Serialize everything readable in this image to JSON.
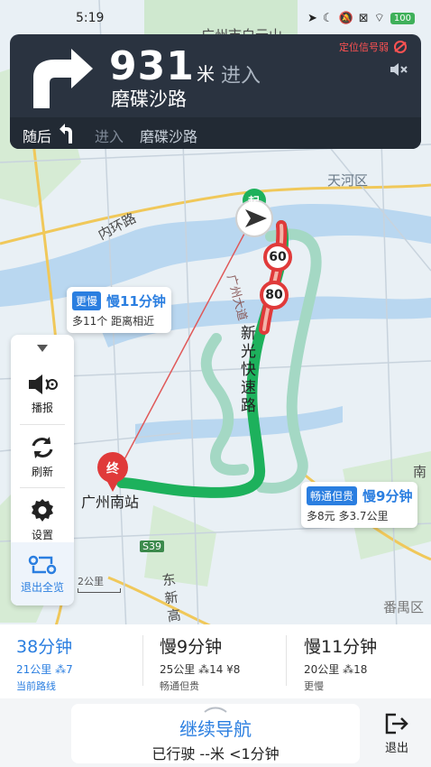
{
  "status_bar": {
    "time": "5:19",
    "battery": "100"
  },
  "nav": {
    "distance": "931",
    "unit": "米",
    "action": "进入",
    "road": "磨碟沙路",
    "gps_warning": "定位信号弱",
    "then_label": "随后",
    "then_action": "进入",
    "then_road": "磨碟沙路"
  },
  "map": {
    "labels": {
      "baiyun": "广州市白云山",
      "tianhe": "天河区",
      "inner_ring": "内环路",
      "xinguang": "新光快速路",
      "nan_station": "广州南站",
      "panyu": "番禺区",
      "nan": "南",
      "dongxin": "东新高速",
      "s39": "S39",
      "start": "起",
      "end": "终",
      "guangzhou_da": "广州大道"
    },
    "speed_signs": [
      "60",
      "80"
    ]
  },
  "bubbles": {
    "left": {
      "tag": "更慢",
      "slow": "慢11分钟",
      "detail": "多11个 距离相近"
    },
    "right": {
      "tag": "畅通但贵",
      "slow": "慢9分钟",
      "detail": "多8元 多3.7公里"
    }
  },
  "toolbar": {
    "broadcast": "播报",
    "refresh": "刷新",
    "settings": "设置",
    "overview": "退出全览"
  },
  "scale": "2公里",
  "routes": [
    {
      "time": "38分钟",
      "detail": "21公里 ⁂7",
      "note": "当前路线"
    },
    {
      "time": "慢9分钟",
      "detail": "25公里 ⁂14 ¥8",
      "note": "畅通但贵"
    },
    {
      "time": "慢11分钟",
      "detail": "20公里 ⁂18",
      "note": "更慢"
    }
  ],
  "bottom": {
    "continue": "继续导航",
    "traveled": "已行驶 --米 <1分钟",
    "exit": "退出"
  },
  "colors": {
    "accent": "#2a7ee0",
    "route_green": "#1db15c",
    "warning_red": "#e03a3a",
    "nav_bg": "#2a3340"
  }
}
